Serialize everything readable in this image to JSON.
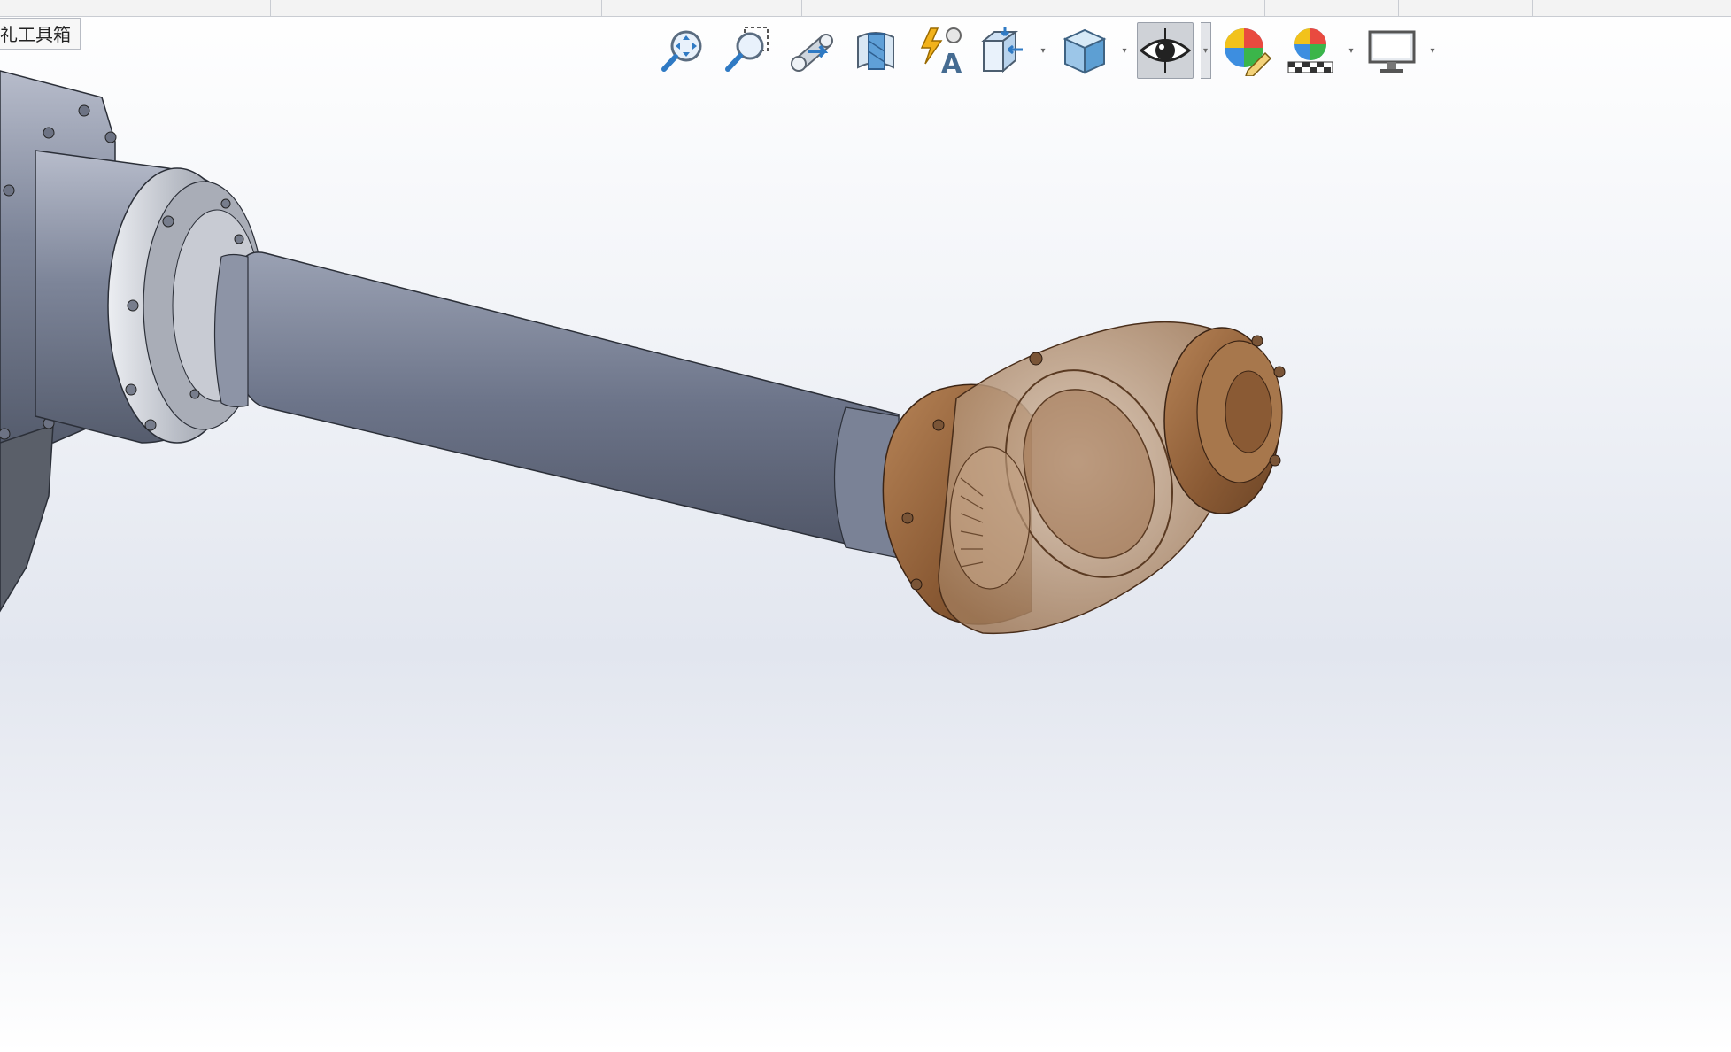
{
  "toolbox_tab": {
    "label": "礼工具箱"
  },
  "heads_up_toolbar": {
    "items": [
      {
        "name": "zoom-to-fit",
        "icon": "zoom-fit-icon",
        "dropdown": false,
        "active": false
      },
      {
        "name": "zoom-to-area",
        "icon": "zoom-area-icon",
        "dropdown": false,
        "active": false
      },
      {
        "name": "previous-view",
        "icon": "previous-view-icon",
        "dropdown": false,
        "active": false
      },
      {
        "name": "section-view",
        "icon": "section-view-icon",
        "dropdown": false,
        "active": false
      },
      {
        "name": "dynamic-annotation-views",
        "icon": "dynamic-annotation-icon",
        "dropdown": false,
        "active": false
      },
      {
        "name": "view-orientation",
        "icon": "view-orientation-icon",
        "dropdown": true,
        "active": false
      },
      {
        "name": "display-style",
        "icon": "display-style-icon",
        "dropdown": true,
        "active": false
      },
      {
        "name": "hide-show-items",
        "icon": "eye-icon",
        "dropdown": true,
        "active": true
      },
      {
        "name": "edit-appearance",
        "icon": "edit-appearance-icon",
        "dropdown": false,
        "active": false
      },
      {
        "name": "apply-scene",
        "icon": "apply-scene-icon",
        "dropdown": true,
        "active": false
      },
      {
        "name": "view-settings",
        "icon": "monitor-icon",
        "dropdown": true,
        "active": false
      }
    ]
  },
  "colors": {
    "arm_metal": "#6c7489",
    "wrist_bronze": "#8a5a34",
    "background_top": "#ffffff",
    "background_mid": "#e2e6ef"
  }
}
